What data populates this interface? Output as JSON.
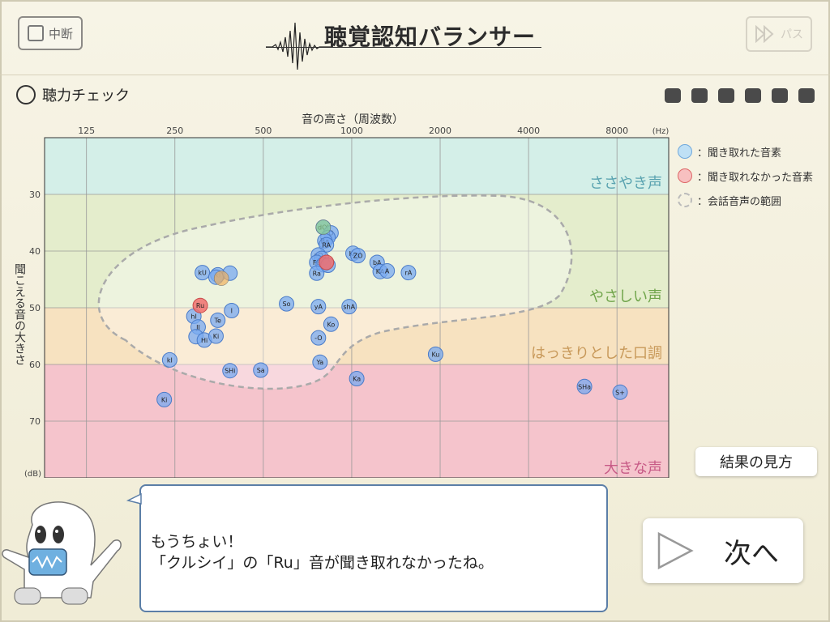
{
  "header": {
    "pause_label": "中断",
    "title": "聴覚認知バランサー",
    "skip_label": "パス"
  },
  "hearing_check": {
    "label": "聴力チェック"
  },
  "progress": {
    "completed": 6,
    "total": 6
  },
  "legend": {
    "heard": "：聞き取れた音素",
    "not_heard": "：聞き取れなかった音素",
    "speech_range": "：会話音声の範囲"
  },
  "result_help_button": "結果の見方",
  "message": {
    "line1": "もうちょい！",
    "line2": "「クルシイ」の「Ru」音が聞き取れなかったね。"
  },
  "next_button": "次へ",
  "colors": {
    "heard": "#8fb8f0",
    "not_heard": "#f08080",
    "whisper_band": "#d4efe8",
    "soft_band": "#e4edcc",
    "clear_band": "#f7e2c0",
    "loud_band": "#f5c4cc"
  },
  "chart_data": {
    "type": "scatter",
    "title": "",
    "xlabel": "音の高さ（周波数）",
    "ylabel": "聞こえる音の大きさ",
    "x_scale": "log",
    "x_unit": "(Hz)",
    "y_unit": "(dB)",
    "x_ticks": [
      125,
      250,
      500,
      1000,
      2000,
      4000,
      8000
    ],
    "y_ticks": [
      30,
      40,
      50,
      60,
      70
    ],
    "xlim": [
      90,
      12000
    ],
    "ylim": [
      20,
      80
    ],
    "y_inverted": true,
    "bands": [
      {
        "label": "ささやき声",
        "from": 20,
        "to": 30,
        "color": "#d4efe8",
        "text_color": "#5aa3b0"
      },
      {
        "label": "やさしい声",
        "from": 30,
        "to": 50,
        "color": "#e4edcc",
        "text_color": "#6fa44a"
      },
      {
        "label": "はっきりとした口調",
        "from": 50,
        "to": 60,
        "color": "#f7e2c0",
        "text_color": "#c8995a"
      },
      {
        "label": "大きな声",
        "from": 60,
        "to": 80,
        "color": "#f5c4cc",
        "text_color": "#c75a86"
      }
    ],
    "series": [
      {
        "name": "聞き取れた音素",
        "points": [
          {
            "label": "kU",
            "x": 310,
            "y": 43.8
          },
          {
            "label": "kI",
            "x": 350,
            "y": 44.2
          },
          {
            "label": "",
            "x": 345,
            "y": 44.6
          },
          {
            "label": "",
            "x": 385,
            "y": 43.9
          },
          {
            "label": "hI",
            "x": 290,
            "y": 51.5
          },
          {
            "label": "JI",
            "x": 300,
            "y": 53.4
          },
          {
            "label": "",
            "x": 295,
            "y": 55.1
          },
          {
            "label": "Hi",
            "x": 315,
            "y": 55.7
          },
          {
            "label": "Ki",
            "x": 345,
            "y": 55.0
          },
          {
            "label": "Te",
            "x": 350,
            "y": 52.2
          },
          {
            "label": "I",
            "x": 390,
            "y": 50.5
          },
          {
            "label": "kI",
            "x": 240,
            "y": 59.2
          },
          {
            "label": "SHi",
            "x": 385,
            "y": 61.1
          },
          {
            "label": "Sa",
            "x": 490,
            "y": 61.0
          },
          {
            "label": "Ki",
            "x": 230,
            "y": 66.2
          },
          {
            "label": "dOl",
            "x": 800,
            "y": 35.8
          },
          {
            "label": "O",
            "x": 850,
            "y": 36.8
          },
          {
            "label": "",
            "x": 830,
            "y": 37.6
          },
          {
            "label": "Ba",
            "x": 810,
            "y": 38.2
          },
          {
            "label": "RA",
            "x": 820,
            "y": 38.9
          },
          {
            "label": "aO",
            "x": 770,
            "y": 40.7
          },
          {
            "label": "",
            "x": 790,
            "y": 41.3
          },
          {
            "label": "FE",
            "x": 760,
            "y": 42.0
          },
          {
            "label": "",
            "x": 800,
            "y": 42.4
          },
          {
            "label": "Ra",
            "x": 760,
            "y": 43.9
          },
          {
            "label": "",
            "x": 830,
            "y": 42.5
          },
          {
            "label": "Ko",
            "x": 1010,
            "y": 40.4
          },
          {
            "label": "ZO",
            "x": 1050,
            "y": 40.8
          },
          {
            "label": "bA",
            "x": 1220,
            "y": 42.0
          },
          {
            "label": "KA",
            "x": 1250,
            "y": 43.6
          },
          {
            "label": "A",
            "x": 1320,
            "y": 43.5
          },
          {
            "label": "rA",
            "x": 1560,
            "y": 43.8
          },
          {
            "label": "So",
            "x": 600,
            "y": 49.3
          },
          {
            "label": "yA",
            "x": 770,
            "y": 49.8
          },
          {
            "label": "shA",
            "x": 980,
            "y": 49.8
          },
          {
            "label": "Ko",
            "x": 850,
            "y": 52.9
          },
          {
            "label": "-O",
            "x": 770,
            "y": 55.3
          },
          {
            "label": "Ya",
            "x": 780,
            "y": 59.6
          },
          {
            "label": "Ka",
            "x": 1040,
            "y": 62.5
          },
          {
            "label": "Ku",
            "x": 1930,
            "y": 58.2
          },
          {
            "label": "SHa",
            "x": 6200,
            "y": 63.9
          },
          {
            "label": "S+",
            "x": 8200,
            "y": 64.9
          }
        ]
      },
      {
        "name": "聞き取れなかった音素",
        "points": [
          {
            "label": "Ru",
            "x": 305,
            "y": 49.6
          },
          {
            "label": "",
            "x": 820,
            "y": 42.0
          }
        ]
      }
    ],
    "highlight_points": [
      {
        "x": 800,
        "y": 35.8,
        "color": "#8fd18f"
      },
      {
        "x": 360,
        "y": 44.8,
        "color": "#f0b060"
      }
    ]
  }
}
